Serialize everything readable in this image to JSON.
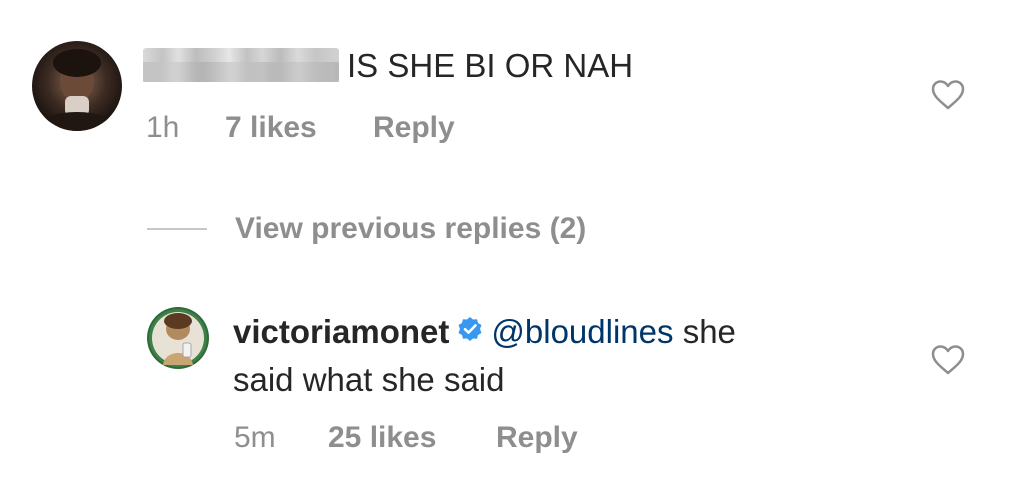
{
  "comments": [
    {
      "text": "IS SHE BI OR NAH",
      "time": "1h",
      "likes": "7 likes",
      "reply_label": "Reply"
    },
    {
      "username": "victoriamonet",
      "mention": "@bloudlines",
      "text_line1": "she",
      "text_line2": "said what she said",
      "time": "5m",
      "likes": "25 likes",
      "reply_label": "Reply"
    }
  ],
  "view_replies_label": "View previous replies (2)",
  "icons": {
    "like": "heart-outline-icon",
    "verified": "verified-badge-icon"
  },
  "colors": {
    "text": "#262626",
    "meta": "#8e8e8e",
    "verified": "#3897f0",
    "mention": "#003569"
  }
}
